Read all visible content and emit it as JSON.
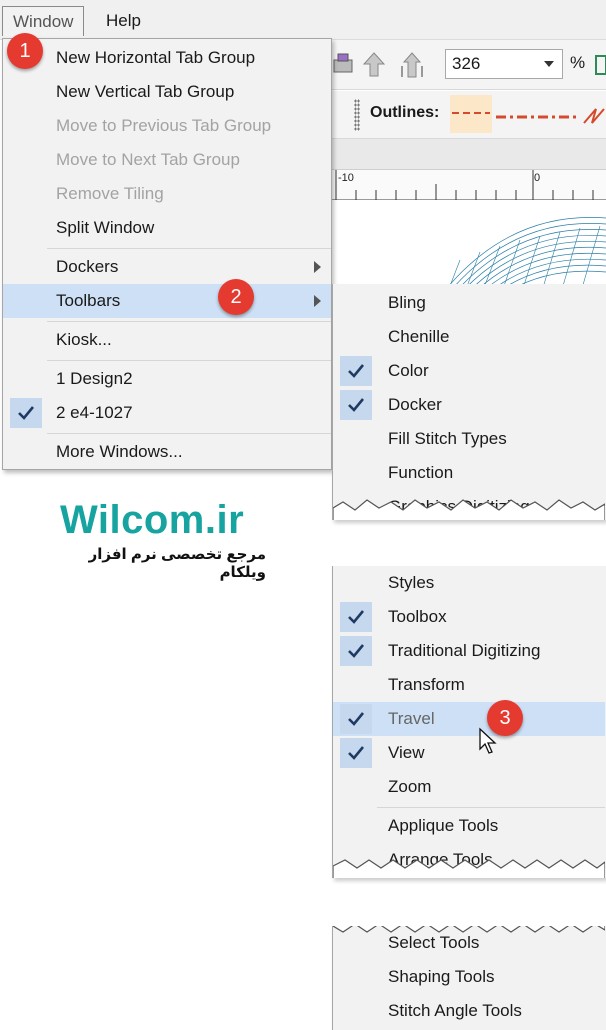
{
  "menubar": {
    "items": [
      "Window",
      "Help"
    ]
  },
  "toolbar": {
    "zoom_value": "326",
    "zoom_unit": "%"
  },
  "outlines_toolbar": {
    "label": "Outlines:"
  },
  "ruler": {
    "labels": [
      "-10",
      "0"
    ]
  },
  "window_menu": {
    "items": [
      {
        "label": "New Horizontal Tab Group",
        "enabled": true
      },
      {
        "label": "New Vertical Tab Group",
        "enabled": true
      },
      {
        "label": "Move to Previous Tab Group",
        "enabled": false
      },
      {
        "label": "Move to Next Tab Group",
        "enabled": false
      },
      {
        "label": "Remove Tiling",
        "enabled": false
      },
      {
        "label": "Split Window",
        "enabled": true
      },
      {
        "label": "Dockers",
        "submenu": true
      },
      {
        "label": "Toolbars",
        "submenu": true,
        "highlighted": true
      },
      {
        "label": "Kiosk..."
      },
      {
        "label": "1 Design2"
      },
      {
        "label": "2 e4-1027",
        "checked": true
      },
      {
        "label": "More Windows..."
      }
    ]
  },
  "toolbars_submenu": {
    "part1": [
      {
        "label": "Bling",
        "checked": false
      },
      {
        "label": "Chenille",
        "checked": false
      },
      {
        "label": "Color",
        "checked": true
      },
      {
        "label": "Docker",
        "checked": true
      },
      {
        "label": "Fill Stitch Types",
        "checked": false
      },
      {
        "label": "Function",
        "checked": false
      },
      {
        "label": "Graphics Digitizing",
        "checked": false
      }
    ],
    "part2": [
      {
        "label": "Styles",
        "checked": false
      },
      {
        "label": "Toolbox",
        "checked": true
      },
      {
        "label": "Traditional Digitizing",
        "checked": true
      },
      {
        "label": "Transform",
        "checked": false
      },
      {
        "label": "Travel",
        "checked": true,
        "highlighted": true
      },
      {
        "label": "View",
        "checked": true
      },
      {
        "label": "Zoom",
        "checked": false
      },
      {
        "label": "Applique Tools",
        "checked": false
      },
      {
        "label": "Arrange Tools",
        "checked": false
      }
    ],
    "part3": [
      {
        "label": "Select Tools",
        "checked": false
      },
      {
        "label": "Shaping Tools",
        "checked": false
      },
      {
        "label": "Stitch Angle Tools",
        "checked": false
      }
    ]
  },
  "callouts": [
    "1",
    "2",
    "3"
  ],
  "watermark": {
    "title": "Wilcom.ir",
    "subtitle": "مرجع تخصصی نرم افزار ویلکام"
  },
  "colors": {
    "accent_badge": "#e43a30",
    "highlight": "#cde0f5",
    "check_bg": "#c6d8ee",
    "brand_teal": "#17a3a0"
  }
}
